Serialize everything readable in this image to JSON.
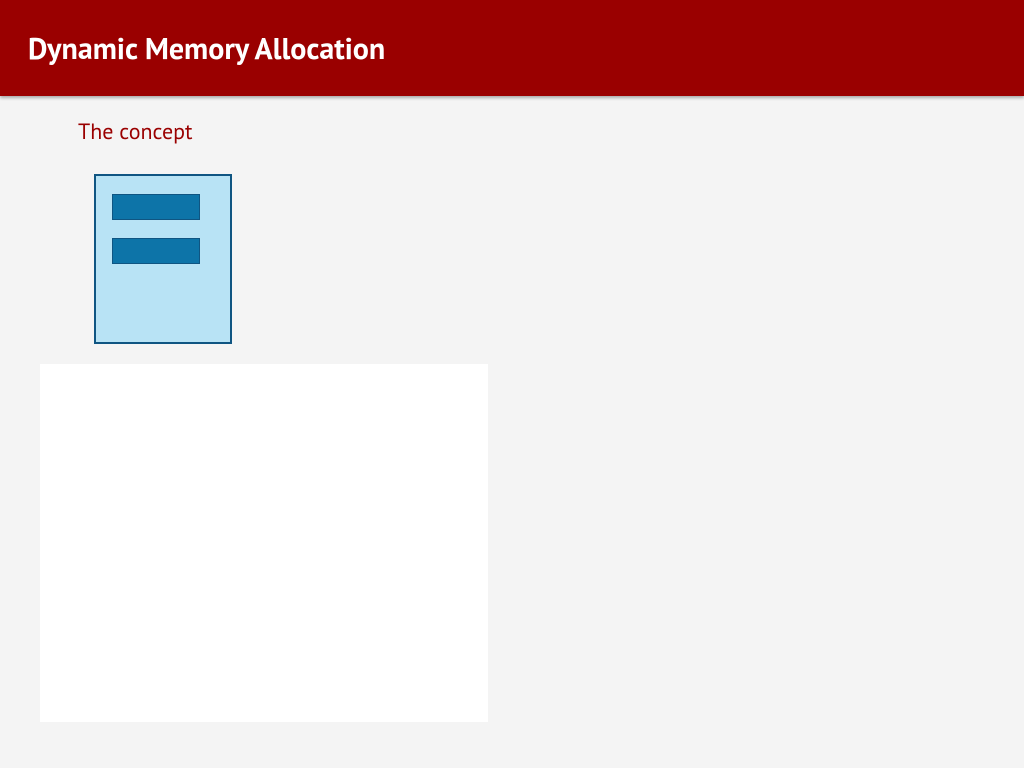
{
  "header": {
    "title": "Dynamic Memory Allocation"
  },
  "subtitle": "The concept",
  "diagram": {
    "box_color": "#b8e3f5",
    "box_border": "#0f5582",
    "slot_color": "#0d74a8",
    "slot_count": 2
  }
}
